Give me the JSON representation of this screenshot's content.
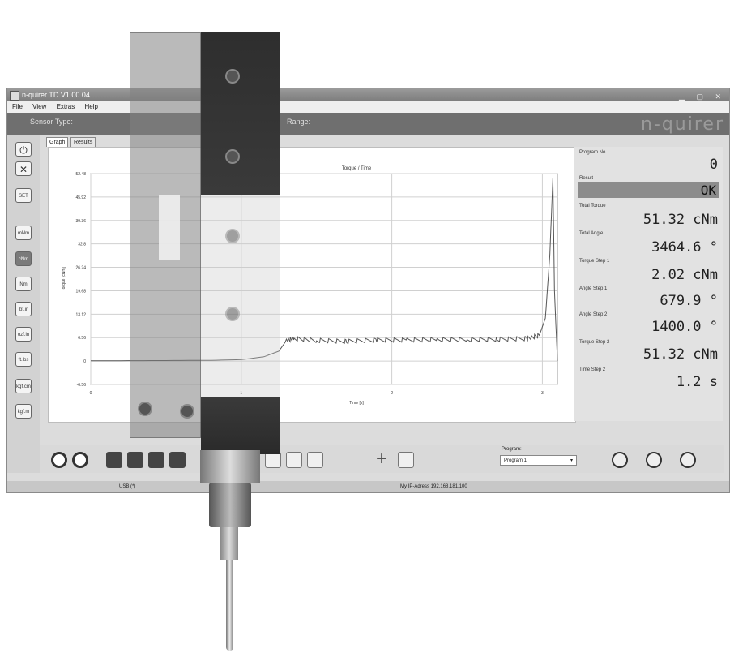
{
  "window": {
    "title": "n-quirer TD V1.00.04",
    "menu": [
      "File",
      "View",
      "Extras",
      "Help"
    ],
    "sensor_type_label": "Sensor Type:",
    "range_label": "Range:",
    "logo": "n-quirer"
  },
  "leftbar": {
    "buttons": [
      "SET",
      "mNm",
      "cNm",
      "Nm",
      "lbf.in",
      "ozf.in",
      "ft.lbs",
      "kgf.cm",
      "kgf.m"
    ]
  },
  "tabs": [
    "Graph",
    "Results"
  ],
  "chart_data": {
    "type": "line",
    "title": "Torque / Time",
    "xlabel": "Time [s]",
    "ylabel": "Torque [cNm]",
    "xlim": [
      0,
      3.1
    ],
    "ylim": [
      -6.56,
      52.48
    ],
    "x_ticks": [
      "0",
      "1",
      "2",
      "3"
    ],
    "y_ticks": [
      "52.48",
      "45.92",
      "39.36",
      "32.8",
      "26.24",
      "19.68",
      "13.12",
      "6.56",
      "0",
      "-6.56"
    ],
    "grid": true,
    "series": [
      {
        "x": [
          0,
          0.2,
          0.5,
          0.8,
          1.0,
          1.15,
          1.25,
          1.3,
          1.35,
          1.5,
          1.7,
          1.9,
          2.1,
          2.3,
          2.5,
          2.7,
          2.9,
          2.98,
          3.02,
          3.05,
          3.07,
          3.08,
          3.1
        ],
        "y": [
          0.1,
          0.1,
          0.15,
          0.2,
          0.4,
          1.2,
          2.8,
          5.8,
          6.3,
          5.8,
          5.5,
          5.9,
          5.9,
          6.0,
          6.0,
          6.1,
          6.3,
          7.2,
          12,
          30,
          51.32,
          20,
          0
        ]
      }
    ]
  },
  "results": {
    "program_no_label": "Program No.",
    "program_no": "0",
    "result_label": "Result",
    "result": "OK",
    "total_torque_label": "Total Torque",
    "total_torque": "51.32 cNm",
    "total_angle_label": "Total Angle",
    "total_angle": "3464.6 °",
    "torque_step1_label": "Torque Step 1",
    "torque_step1": "2.02 cNm",
    "angle_step1_label": "Angle Step 1",
    "angle_step1": "679.9 °",
    "angle_step2_label": "Angle Step 2",
    "angle_step2": "1400.0 °",
    "torque_step2_label": "Torque Step 2",
    "torque_step2": "51.32 cNm",
    "time_step2_label": "Time Step 2",
    "time_step2": "1.2 s"
  },
  "toolbar": {
    "program_label": "Program:",
    "program_value": "Program 1"
  },
  "status": {
    "usb": "USB (*)",
    "ip": "My IP-Adress 192.168.181.100"
  }
}
